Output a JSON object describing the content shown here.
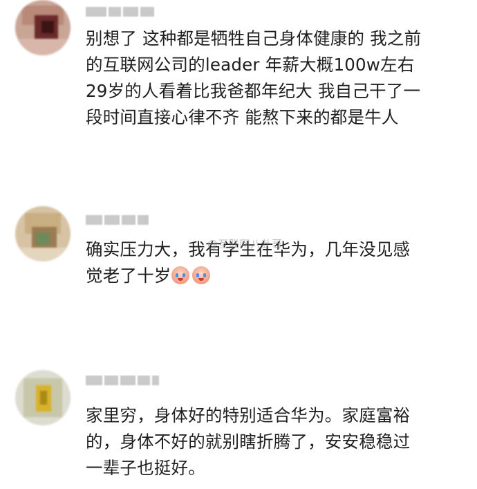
{
  "comments": [
    {
      "text": "别想了 这种都是牺牲自己身体健康的 我之前\n的互联网公司的leader 年薪大概100w左右\n29岁的人看着比我爸都年纪大 我自己干了一\n段时间直接心律不齐 能熬下来的都是牛人",
      "emojis": []
    },
    {
      "text": "确实压力大，我有学生在华为，几年没见感\n觉老了十岁",
      "emojis": [
        "crying-face-icon",
        "crying-face-icon"
      ]
    },
    {
      "text": "家里穷，身体好的特别适合华为。家庭富裕\n的，身体不好的就别瞎折腾了，安安稳稳过\n一辈子也挺好。",
      "emojis": []
    }
  ],
  "watermark": "@互联网八卦哥"
}
